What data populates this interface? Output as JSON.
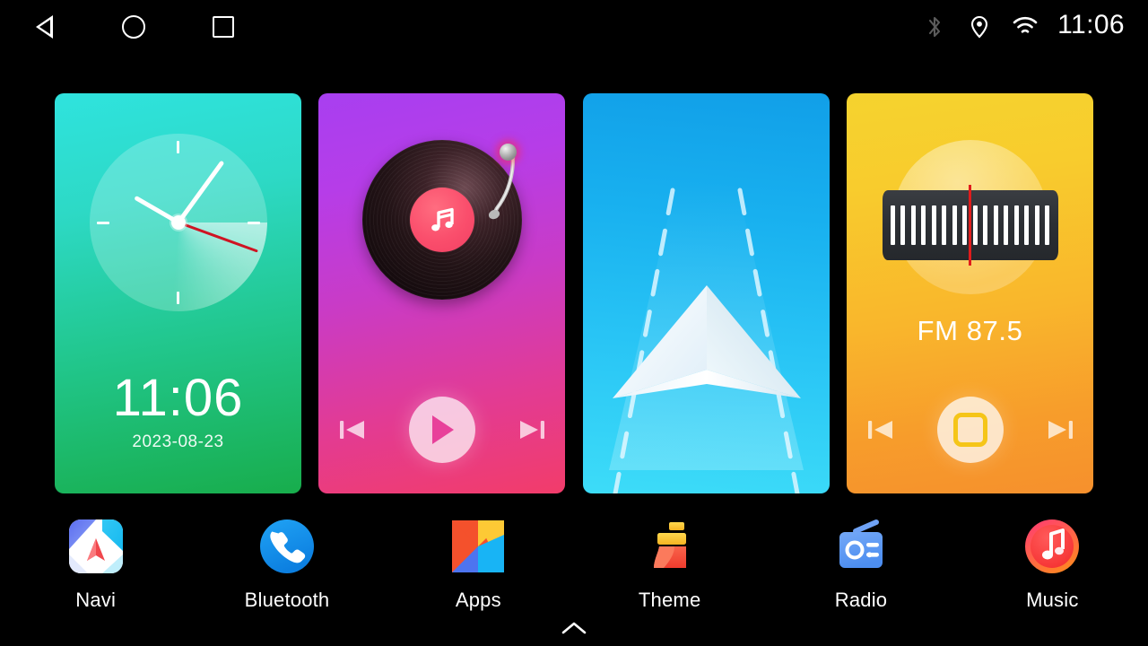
{
  "statusbar": {
    "nav": {
      "back": "back-icon",
      "home": "home-icon",
      "recents": "recents-icon"
    },
    "icons": {
      "bluetooth": "bluetooth-icon",
      "location": "location-pin-icon",
      "wifi": "wifi-icon"
    },
    "time": "11:06",
    "colors": {
      "bluetooth_inactive": "#5b5b5b",
      "active": "#ffffff",
      "background": "#000000"
    }
  },
  "widgets": {
    "clock": {
      "name": "Clock",
      "time": "11:06",
      "date": "2023-08-23",
      "hour_deg": -150,
      "minute_deg": -54,
      "second_deg": 20,
      "gradient_from": "#2fe3de",
      "gradient_to": "#18ad4c",
      "second_hand_color": "#cf1423"
    },
    "music": {
      "name": "Music",
      "label_icon": "music-note-icon",
      "prev_label": "previous-track",
      "play_label": "play",
      "next_label": "next-track",
      "gradient_from": "#a83ff0",
      "gradient_to": "#f23c6a",
      "label_color": "#fa4e6c"
    },
    "navi": {
      "name": "Navigation",
      "icon": "navigation-arrow-icon",
      "gradient_from": "#119fe8",
      "gradient_to": "#3ddcf8"
    },
    "radio": {
      "name": "Radio",
      "frequency": "FM 87.5",
      "prev_label": "previous-station",
      "stop_label": "stop",
      "next_label": "next-station",
      "tick_count": 16,
      "gradient_from": "#f5d32e",
      "gradient_to": "#f6902d",
      "needle_color": "#e01c1c",
      "stop_color": "#f5c518"
    }
  },
  "dock": {
    "items": [
      {
        "label": "Navi",
        "icon": "navi-app-icon"
      },
      {
        "label": "Bluetooth",
        "icon": "phone-handset-icon"
      },
      {
        "label": "Apps",
        "icon": "apps-grid-icon"
      },
      {
        "label": "Theme",
        "icon": "theme-brush-icon"
      },
      {
        "label": "Radio",
        "icon": "radio-app-icon"
      },
      {
        "label": "Music",
        "icon": "music-note-app-icon"
      }
    ],
    "drawer_handle": "chevron-up-icon"
  }
}
